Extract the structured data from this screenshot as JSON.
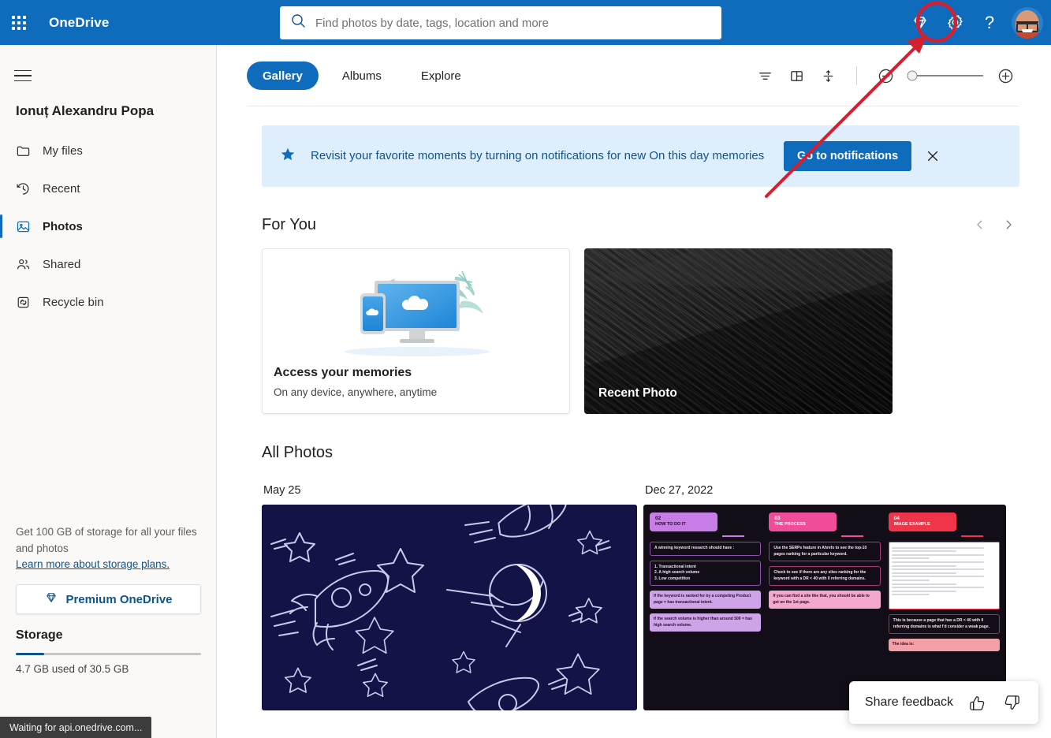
{
  "header": {
    "brand": "OneDrive",
    "waffle_icon": "app-launcher-icon",
    "search": {
      "placeholder": "Find photos by date, tags, location and more",
      "value": "",
      "icon": "search-icon"
    },
    "premium_icon": "diamond-icon",
    "settings_icon": "gear-icon",
    "help_label": "?",
    "avatar_alt": "Account manager",
    "bg_color": "#0f6cbd"
  },
  "sidebar": {
    "menu_icon": "hamburger-icon",
    "user_name": "Ionuț Alexandru Popa",
    "items": [
      {
        "label": "My files",
        "icon": "folder-icon",
        "active": false
      },
      {
        "label": "Recent",
        "icon": "clock-icon",
        "active": false
      },
      {
        "label": "Photos",
        "icon": "photo-icon",
        "active": true
      },
      {
        "label": "Shared",
        "icon": "people-icon",
        "active": false
      },
      {
        "label": "Recycle bin",
        "icon": "recycle-bin-icon",
        "active": false
      }
    ],
    "storage": {
      "promo": "Get 100 GB of storage for all your files and photos",
      "link": "Learn more about storage plans.",
      "premium_button": "Premium OneDrive",
      "premium_icon": "diamond-icon",
      "title": "Storage",
      "used_text": "4.7 GB used of 30.5 GB",
      "percent_used": 15.4,
      "bar_color": "#0f548c"
    }
  },
  "toolbar": {
    "tabs": [
      {
        "label": "Gallery",
        "active": true
      },
      {
        "label": "Albums",
        "active": false
      },
      {
        "label": "Explore",
        "active": false
      }
    ],
    "filter_icon": "filter-icon",
    "layout_icon": "layout-grid-icon",
    "sort_icon": "sort-vertical-icon",
    "zoom_out_icon": "zoom-out-icon",
    "zoom_in_icon": "zoom-in-icon",
    "zoom_value": 0
  },
  "banner": {
    "icon": "star-icon",
    "message": "Revisit your favorite moments by turning on notifications for new On this day memories",
    "button": "Go to notifications",
    "close_icon": "close-icon",
    "bg_color": "#dfeefc"
  },
  "for_you": {
    "title": "For You",
    "prev_icon": "chevron-left-icon",
    "next_icon": "chevron-right-icon",
    "cards": [
      {
        "type": "memories",
        "title": "Access your memories",
        "subtitle": "On any device, anywhere, anytime",
        "illustration": "devices-cloud-illustration"
      },
      {
        "type": "photo",
        "title": "Recent Photo",
        "image": "dark-sand-dune-photo"
      }
    ]
  },
  "all_photos": {
    "title": "All Photos",
    "groups": [
      {
        "date": "May 25",
        "image": "space-doodles-navy-thumbnail"
      },
      {
        "date": "Dec 27, 2022",
        "image": "seo-infographic-thumbnail"
      }
    ]
  },
  "infographic": {
    "columns": [
      {
        "number": "02",
        "heading": "HOW TO DO IT",
        "boxes": [
          "A winning keyword research should have :",
          "1. Transactional intent\n2. A high search volume\n3. Low competition",
          "If the keyword is ranked for by a competing Product page = has transactional intent.",
          "If the search volume is higher than around 500 = has high search volume."
        ]
      },
      {
        "number": "03",
        "heading": "THE PROCESS",
        "boxes": [
          "Use the SERPs feature in Ahrefs to see the top-10 pages ranking for a particular keyword.",
          "Check to see if there are any sites ranking for the keyword with a DR < 40 with 0 referring domains.",
          "If you can find a site like that, you should be able to get on the 1st page."
        ]
      },
      {
        "number": "04",
        "heading": "IMAGE EXAMPLE",
        "boxes": [
          "This is because a page that has a DR < 40 with 0 referring domains is what I'd consider a weak page.",
          "The idea is:"
        ]
      }
    ]
  },
  "share_feedback": {
    "label": "Share feedback",
    "thumbs_up_icon": "thumbs-up-icon",
    "thumbs_down_icon": "thumbs-down-icon"
  },
  "status_bar": {
    "text": "Waiting for api.onedrive.com..."
  },
  "annotation": {
    "highlight_target": "gear-icon",
    "color": "#d32030"
  }
}
